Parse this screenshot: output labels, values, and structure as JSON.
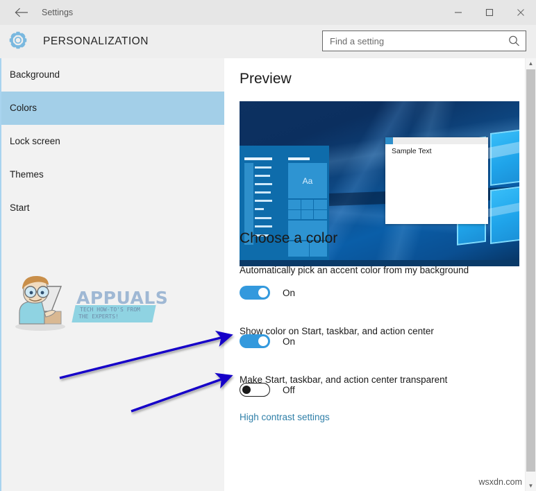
{
  "window": {
    "title": "Settings",
    "back_icon": "back-arrow-icon",
    "minimize_icon": "minimize-icon",
    "maximize_icon": "maximize-icon",
    "close_icon": "close-icon"
  },
  "header": {
    "icon": "gear-icon",
    "title": "PERSONALIZATION"
  },
  "search": {
    "placeholder": "Find a setting",
    "value": "",
    "icon": "search-icon"
  },
  "sidebar": {
    "items": [
      {
        "label": "Background",
        "selected": false
      },
      {
        "label": "Colors",
        "selected": true
      },
      {
        "label": "Lock screen",
        "selected": false
      },
      {
        "label": "Themes",
        "selected": false
      },
      {
        "label": "Start",
        "selected": false
      }
    ]
  },
  "content": {
    "preview": {
      "heading": "Preview",
      "start_tile_text": "Aa",
      "sample_window_text": "Sample Text"
    },
    "choose_color": {
      "heading": "Choose a color",
      "settings": [
        {
          "label": "Automatically pick an accent color from my background",
          "state": "On",
          "on": true
        },
        {
          "label": "Show color on Start, taskbar, and action center",
          "state": "On",
          "on": true
        },
        {
          "label": "Make Start, taskbar, and action center transparent",
          "state": "Off",
          "on": false
        }
      ],
      "link": "High contrast settings"
    }
  },
  "scrollbar": {
    "up_arrow": "chevron-up-icon",
    "down_arrow": "chevron-down-icon"
  },
  "watermarks": {
    "appuals_name": "APPUALS",
    "appuals_tagline_line1": "TECH HOW-TO'S FROM",
    "appuals_tagline_line2": "THE EXPERTS!",
    "site": "wsxdn.com"
  },
  "colors": {
    "accent": "#3399dd",
    "selection": "#a3cfe8",
    "link": "#2f7fa8",
    "annotation_arrow": "#1200c8",
    "titlebar_bg": "#e6e6e6",
    "header_bg": "#eeeeee",
    "sidebar_bg": "#f2f2f2"
  }
}
